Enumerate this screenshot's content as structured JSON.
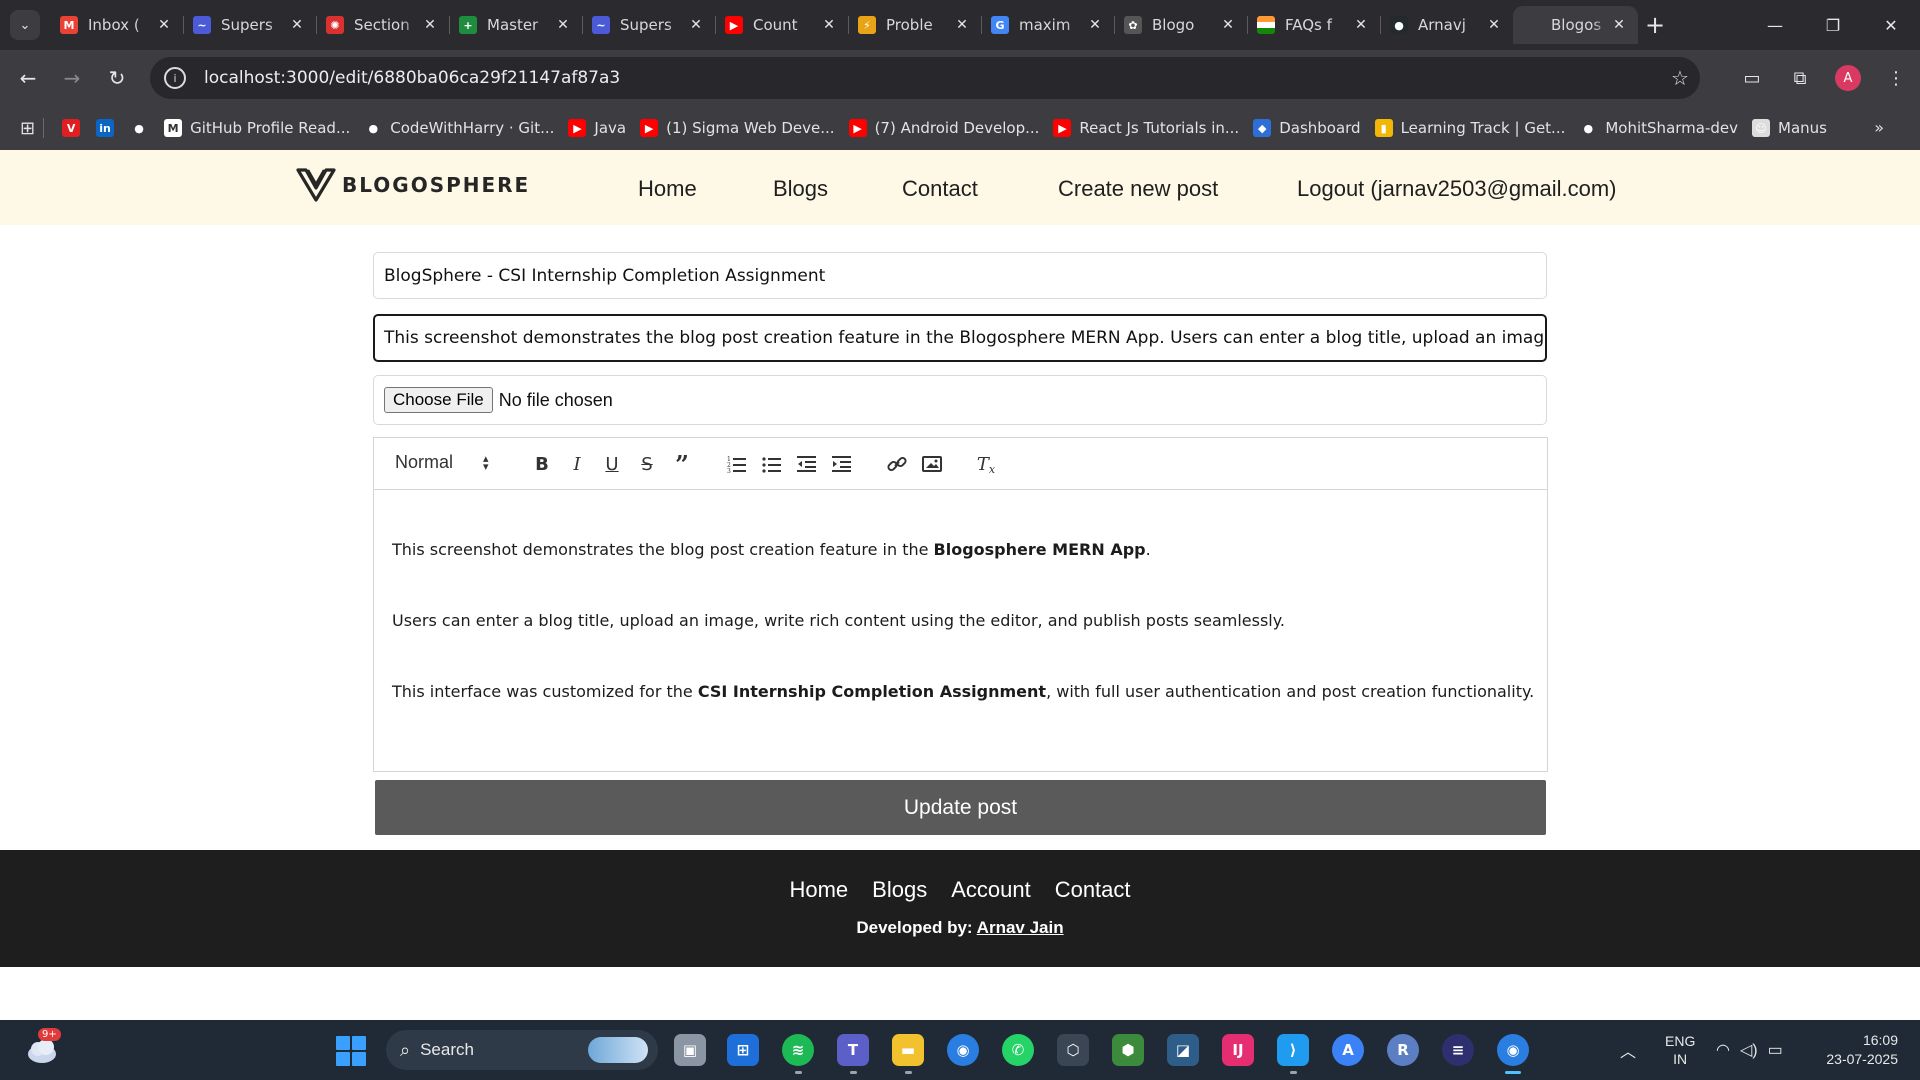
{
  "browser": {
    "tabs": [
      {
        "title": "Inbox (",
        "icon": "gmail-icon",
        "color": "#ea4335",
        "glyph": "M",
        "active": false
      },
      {
        "title": "Supers",
        "icon": "supersonic-icon",
        "color": "#4b5bd8",
        "glyph": "~",
        "active": false
      },
      {
        "title": "Section",
        "icon": "section-icon",
        "color": "#d93030",
        "glyph": "✺",
        "active": false
      },
      {
        "title": "Master",
        "icon": "sheets-icon",
        "color": "#1e8e3e",
        "glyph": "+",
        "active": false
      },
      {
        "title": "Supers",
        "icon": "supersonic-icon",
        "color": "#4b5bd8",
        "glyph": "~",
        "active": false
      },
      {
        "title": "Count",
        "icon": "youtube-icon",
        "color": "#ff0000",
        "glyph": "▶",
        "active": false
      },
      {
        "title": "Proble",
        "icon": "problem-icon",
        "color": "#e8a317",
        "glyph": "⚡",
        "active": false
      },
      {
        "title": "maxim",
        "icon": "google-icon",
        "color": "#4285f4",
        "glyph": "G",
        "active": false
      },
      {
        "title": "Blogo",
        "icon": "openai-icon",
        "color": "#555555",
        "glyph": "✿",
        "active": false
      },
      {
        "title": "FAQs f",
        "icon": "india-flag-icon",
        "color": "#ff9933",
        "glyph": "",
        "active": false
      },
      {
        "title": "Arnavj",
        "icon": "github-icon",
        "color": "#24292e",
        "glyph": "●",
        "active": false
      },
      {
        "title": "Blogos",
        "icon": "blank-page-icon",
        "color": "#3c3c41",
        "glyph": "",
        "active": true
      }
    ],
    "url": "localhost:3000/edit/6880ba06ca29f21147af87a3",
    "bookmarks": [
      {
        "label": "",
        "icon": "vivaldi-icon",
        "color": "#e02020",
        "glyph": "V"
      },
      {
        "label": "",
        "icon": "linkedin-icon",
        "color": "#0a66c2",
        "glyph": "in"
      },
      {
        "label": "",
        "icon": "github-icon",
        "color": "#3c3c41",
        "glyph": "●"
      },
      {
        "label": "GitHub Profile Read...",
        "icon": "readme-icon",
        "color": "#ffffff",
        "glyph": "M"
      },
      {
        "label": "CodeWithHarry · Git...",
        "icon": "github-icon",
        "color": "#3c3c41",
        "glyph": "●"
      },
      {
        "label": "Java",
        "icon": "youtube-icon",
        "color": "#ff0000",
        "glyph": "▶"
      },
      {
        "label": "(1) Sigma Web Deve...",
        "icon": "youtube-icon",
        "color": "#ff0000",
        "glyph": "▶"
      },
      {
        "label": "(7) Android Develop...",
        "icon": "youtube-icon",
        "color": "#ff0000",
        "glyph": "▶"
      },
      {
        "label": "React Js Tutorials in...",
        "icon": "youtube-icon",
        "color": "#ff0000",
        "glyph": "▶"
      },
      {
        "label": "Dashboard",
        "icon": "dashboard-icon",
        "color": "#2d6fd6",
        "glyph": "◆"
      },
      {
        "label": "Learning Track | Get...",
        "icon": "learning-track-icon",
        "color": "#f2b705",
        "glyph": "▮"
      },
      {
        "label": "MohitSharma-dev",
        "icon": "github-icon",
        "color": "#3c3c41",
        "glyph": "●"
      },
      {
        "label": "Manus",
        "icon": "manus-icon",
        "color": "#dddddd",
        "glyph": "☺"
      }
    ]
  },
  "site": {
    "brand": "BLOGOSPHERE",
    "nav": [
      "Home",
      "Blogs",
      "Contact",
      "Create new post",
      "Logout (jarnav2503@gmail.com)"
    ]
  },
  "form": {
    "title_value": "BlogSphere - CSI Internship Completion Assignment",
    "summary_value": "This screenshot demonstrates the blog post creation feature in the Blogosphere MERN App. Users can enter a blog title, upload an image, write rich content using the editor, and publish posts seamlessly.",
    "file_button": "Choose File",
    "file_status": "No file chosen",
    "heading_select": "Normal",
    "editor_paragraphs": [
      {
        "before": "This screenshot demonstrates the blog post creation feature in the ",
        "bold": "Blogosphere MERN App",
        "after": "."
      },
      {
        "before": "Users can enter a blog title, upload an image, write rich content using the editor, and publish posts seamlessly.",
        "bold": "",
        "after": ""
      },
      {
        "before": "This interface was customized for the ",
        "bold": "CSI Internship Completion Assignment",
        "after": ", with full user authentication and post creation functionality."
      }
    ],
    "submit_label": "Update post"
  },
  "footer": {
    "nav": [
      "Home",
      "Blogs",
      "Account",
      "Contact"
    ],
    "credit_label": "Developed by: ",
    "credit_name": "Arnav Jain"
  },
  "taskbar": {
    "weather_badge": "9+",
    "search_label": "Search",
    "lang_top": "ENG",
    "lang_bottom": "IN",
    "time": "16:09",
    "date": "23-07-2025"
  },
  "colors": {
    "header_bg": "#fef8e7",
    "footer_bg": "#1e1e1e",
    "button_bg": "#5a5a5a"
  }
}
